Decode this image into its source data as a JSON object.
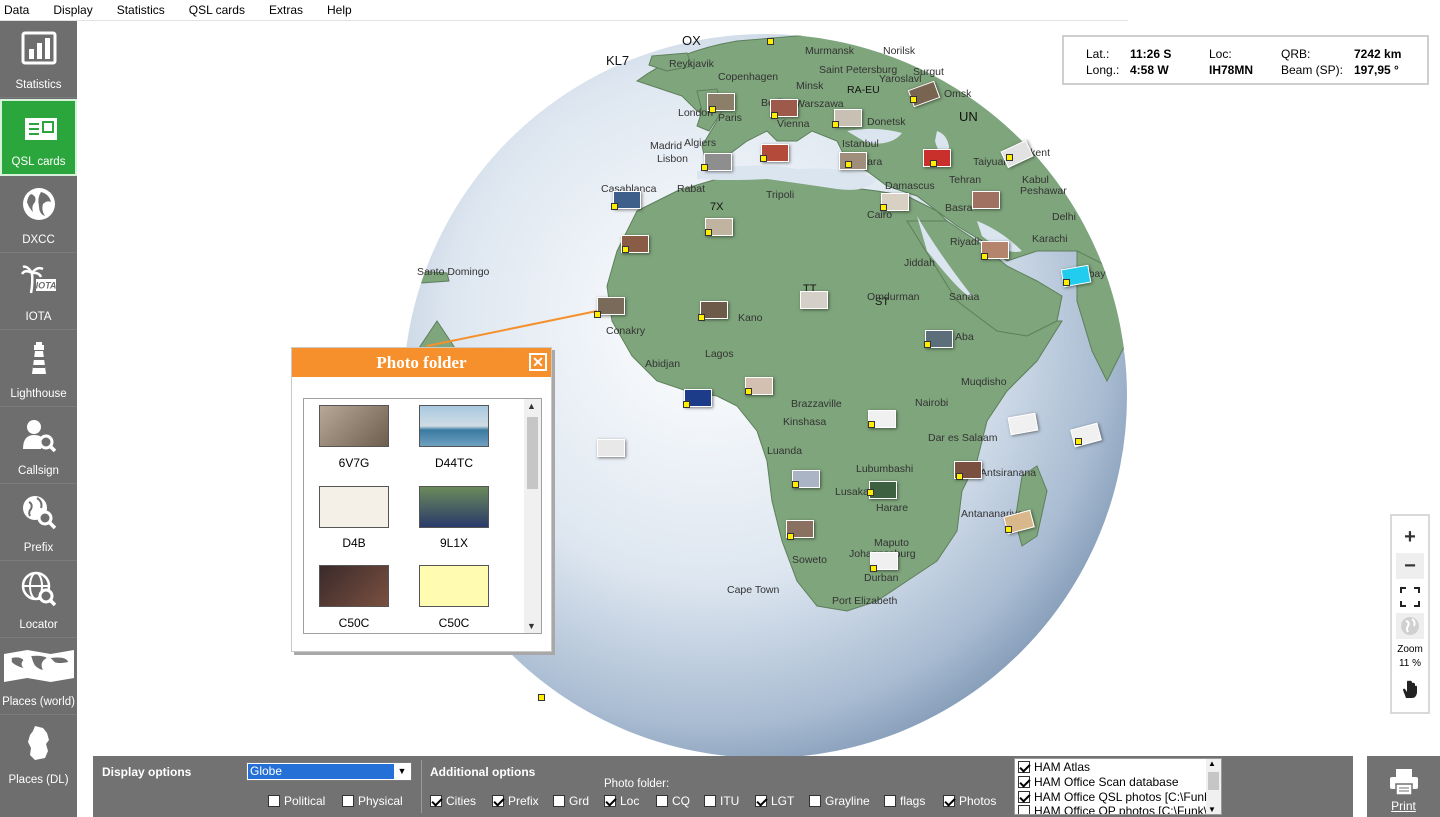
{
  "menu": [
    "Data",
    "Display",
    "Statistics",
    "QSL cards",
    "Extras",
    "Help"
  ],
  "sidebar": [
    {
      "label": "Statistics",
      "icon": "statistics-icon"
    },
    {
      "label": "QSL cards",
      "icon": "qsl-card-icon",
      "active": true
    },
    {
      "label": "DXCC",
      "icon": "globe-icon"
    },
    {
      "label": "IOTA",
      "icon": "iota-palm-icon"
    },
    {
      "label": "Lighthouse",
      "icon": "lighthouse-icon"
    },
    {
      "label": "Callsign",
      "icon": "callsign-search-icon"
    },
    {
      "label": "Prefix",
      "icon": "prefix-search-icon"
    },
    {
      "label": "Locator",
      "icon": "locator-globe-icon"
    },
    {
      "label": "Places (world)",
      "icon": "world-map-icon"
    },
    {
      "label": "Places (DL)",
      "icon": "germany-map-icon"
    }
  ],
  "info": {
    "lat_label": "Lat.:",
    "lat": "11:26 S",
    "long_label": "Long.:",
    "long": "4:58 W",
    "loc_label": "Loc:",
    "loc": "IH78MN",
    "qrb_label": "QRB:",
    "qrb": "7242 km",
    "beam_label": "Beam (SP):",
    "beam": "197,95 °"
  },
  "zoom": {
    "label": "Zoom",
    "value": "11 %"
  },
  "cities": [
    "Murmansk",
    "Norilsk",
    "Reykjavik",
    "Saint Petersburg",
    "Surgut",
    "Yaroslavl",
    "Copenhagen",
    "Minsk",
    "Omsk",
    "Berlin",
    "Warszawa",
    "London",
    "Vienna",
    "Donetsk",
    "Paris",
    "Madrid",
    "Algiers",
    "Istanbul",
    "Taiyuan",
    "Lisbon",
    "Ankara",
    "Tehran",
    "Peshawar",
    "Casablanca",
    "Rabat",
    "Damascus",
    "Kabul",
    "Tripoli",
    "Basra",
    "Cairo",
    "Delhi",
    "Riyadh",
    "Karachi",
    "Santo Domingo",
    "Jiddah",
    "Bombay",
    "Omdurman",
    "Sanaa",
    "Kano",
    "Conakry",
    "Aba",
    "Lagos",
    "Abidjan",
    "Muqdisho",
    "Brazzaville",
    "Nairobi",
    "Kinshasa",
    "Dar es Salaam",
    "Luanda",
    "Lubumbashi",
    "Antsiranana",
    "Lusaka",
    "Harare",
    "Antananarivo",
    "Maputo",
    "Johannesburg",
    "Soweto",
    "Durban",
    "Cape Town",
    "Port Elizabeth",
    "Tashkent"
  ],
  "prefixes": [
    "OX",
    "KL7",
    "RA-EU",
    "UN",
    "7X",
    "TT",
    "ST"
  ],
  "photo_folder": {
    "title": "Photo folder",
    "items": [
      {
        "label": "6V7G"
      },
      {
        "label": "D44TC"
      },
      {
        "label": "D4B"
      },
      {
        "label": "9L1X"
      },
      {
        "label": "C50C"
      },
      {
        "label": "C50C"
      }
    ]
  },
  "bottom": {
    "display_options_label": "Display options",
    "display_value": "Globe",
    "political": "Political",
    "physical": "Physical",
    "additional_label": "Additional options",
    "photo_folder_label": "Photo folder:",
    "options": [
      {
        "label": "Cities",
        "checked": true
      },
      {
        "label": "Prefix",
        "checked": true
      },
      {
        "label": "Grd",
        "checked": false
      },
      {
        "label": "Loc",
        "checked": true
      },
      {
        "label": "CQ",
        "checked": false
      },
      {
        "label": "ITU",
        "checked": false
      },
      {
        "label": "LGT",
        "checked": true
      },
      {
        "label": "Grayline",
        "checked": false
      },
      {
        "label": "flags",
        "checked": false
      },
      {
        "label": "Photos",
        "checked": true
      }
    ],
    "sources": [
      {
        "label": "HAM Atlas",
        "checked": true
      },
      {
        "label": "HAM Office Scan database",
        "checked": true
      },
      {
        "label": "HAM Office QSL photos [C:\\Funk\\",
        "checked": true
      },
      {
        "label": "HAM Office OP photos [C:\\Funk\\",
        "checked": false
      }
    ],
    "print_label": "Print"
  },
  "colors": {
    "sidebar": "#6e6e6e",
    "active": "#2aa63d",
    "accent": "#f5902d",
    "land": "#7fa57c",
    "ocean": "#b8c9dc"
  }
}
